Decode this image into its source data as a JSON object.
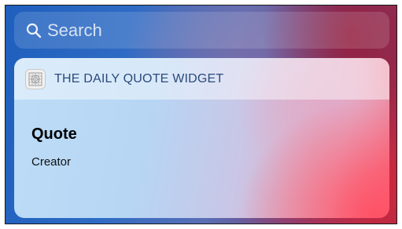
{
  "search": {
    "placeholder": "Search",
    "icon": "search-icon"
  },
  "widget": {
    "app_icon": "app-grid-icon",
    "title": "THE DAILY QUOTE WIDGET",
    "quote": "Quote",
    "creator": "Creator"
  },
  "colors": {
    "widget_title": "#2a4a7a",
    "search_placeholder": "#ffffffc7"
  }
}
